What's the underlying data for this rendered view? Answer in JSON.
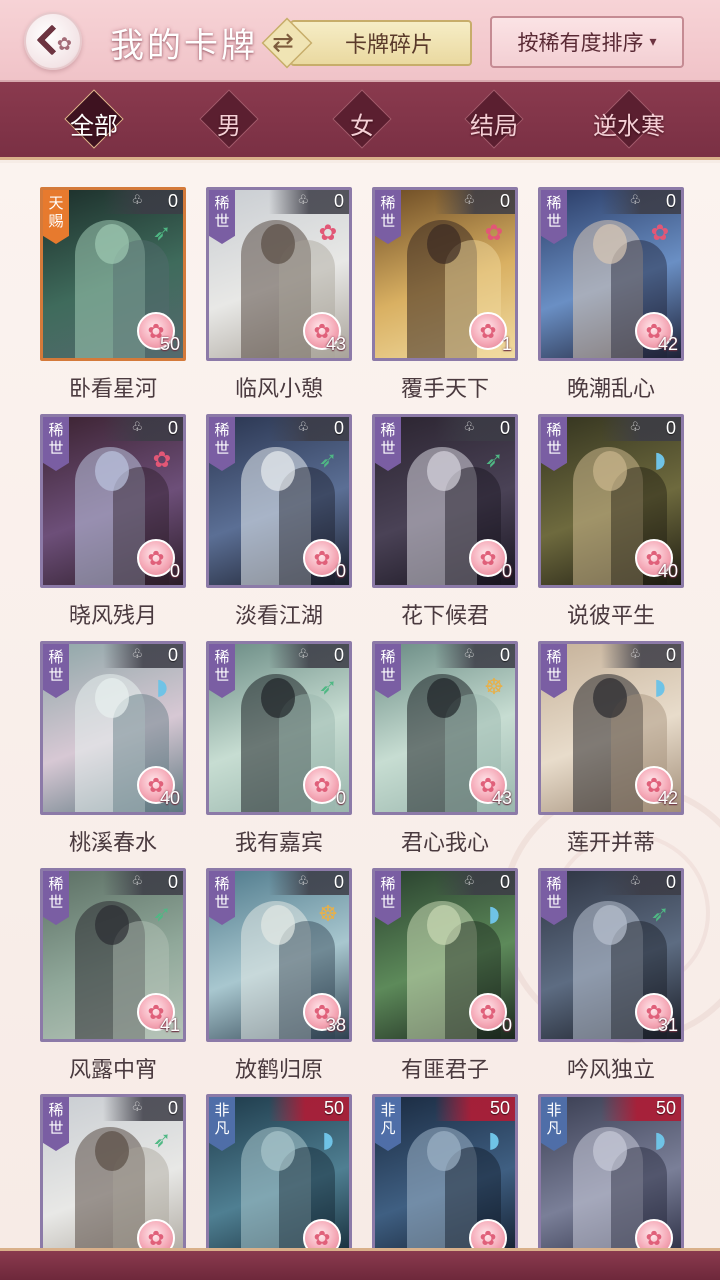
{
  "header": {
    "title": "我的卡牌",
    "fragments_label": "卡牌碎片",
    "sort_label": "按稀有度排序",
    "swap_glyph": "⇄"
  },
  "filters": [
    {
      "label": "全部",
      "active": true
    },
    {
      "label": "男",
      "active": false
    },
    {
      "label": "女",
      "active": false
    },
    {
      "label": "结局",
      "active": false
    },
    {
      "label": "逆水寒",
      "active": false
    }
  ],
  "cards": [
    {
      "name": "卧看星河",
      "rarity": "天赐",
      "count": "0",
      "level": "50",
      "attr": "bow",
      "palette": "teal"
    },
    {
      "name": "临风小憩",
      "rarity": "稀世",
      "count": "0",
      "level": "43",
      "attr": "flower",
      "palette": "white"
    },
    {
      "name": "覆手天下",
      "rarity": "稀世",
      "count": "0",
      "level": "1",
      "attr": "flower",
      "palette": "gold"
    },
    {
      "name": "晚潮乱心",
      "rarity": "稀世",
      "count": "0",
      "level": "42",
      "attr": "flower",
      "palette": "blue"
    },
    {
      "name": "晓风残月",
      "rarity": "稀世",
      "count": "0",
      "level": "0",
      "attr": "flower",
      "palette": "dusk"
    },
    {
      "name": "淡看江湖",
      "rarity": "稀世",
      "count": "0",
      "level": "0",
      "attr": "bow",
      "palette": "night"
    },
    {
      "name": "花下候君",
      "rarity": "稀世",
      "count": "0",
      "level": "0",
      "attr": "bow",
      "palette": "dark"
    },
    {
      "name": "说彼平生",
      "rarity": "稀世",
      "count": "0",
      "level": "40",
      "attr": "fan",
      "palette": "olive"
    },
    {
      "name": "桃溪春水",
      "rarity": "稀世",
      "count": "0",
      "level": "40",
      "attr": "fan",
      "palette": "spring"
    },
    {
      "name": "我有嘉宾",
      "rarity": "稀世",
      "count": "0",
      "level": "0",
      "attr": "bow",
      "palette": "mint"
    },
    {
      "name": "君心我心",
      "rarity": "稀世",
      "count": "0",
      "level": "43",
      "attr": "gold",
      "palette": "mint"
    },
    {
      "name": "莲开并蒂",
      "rarity": "稀世",
      "count": "0",
      "level": "42",
      "attr": "fan",
      "palette": "cream"
    },
    {
      "name": "风露中宵",
      "rarity": "稀世",
      "count": "0",
      "level": "41",
      "attr": "bow",
      "palette": "jade"
    },
    {
      "name": "放鹤归原",
      "rarity": "稀世",
      "count": "0",
      "level": "38",
      "attr": "gold",
      "palette": "lake"
    },
    {
      "name": "有匪君子",
      "rarity": "稀世",
      "count": "0",
      "level": "0",
      "attr": "fan",
      "palette": "bamboo"
    },
    {
      "name": "吟风独立",
      "rarity": "稀世",
      "count": "0",
      "level": "31",
      "attr": "bow",
      "palette": "steel"
    },
    {
      "name": "",
      "rarity": "稀世",
      "count": "0",
      "level": "",
      "attr": "bow",
      "palette": "white"
    },
    {
      "name": "",
      "rarity": "非凡",
      "count": "50",
      "level": "",
      "attr": "fan",
      "palette": "rain"
    },
    {
      "name": "",
      "rarity": "非凡",
      "count": "50",
      "level": "",
      "attr": "fan",
      "palette": "sea"
    },
    {
      "name": "",
      "rarity": "非凡",
      "count": "50",
      "level": "",
      "attr": "fan",
      "palette": "mist"
    }
  ],
  "colors": {
    "accent": "#8a3a4e",
    "card_border": "#8c7aa8",
    "tianci": "#e77a2e",
    "xishi": "#7a5ea3",
    "feifan": "#4f6ea8"
  },
  "icons": {
    "back": "back-arrow-icon",
    "swap": "swap-icon",
    "sort_caret": "chevron-down-icon",
    "card_count_suit": "club-icon",
    "level": "blossom-badge-icon"
  }
}
